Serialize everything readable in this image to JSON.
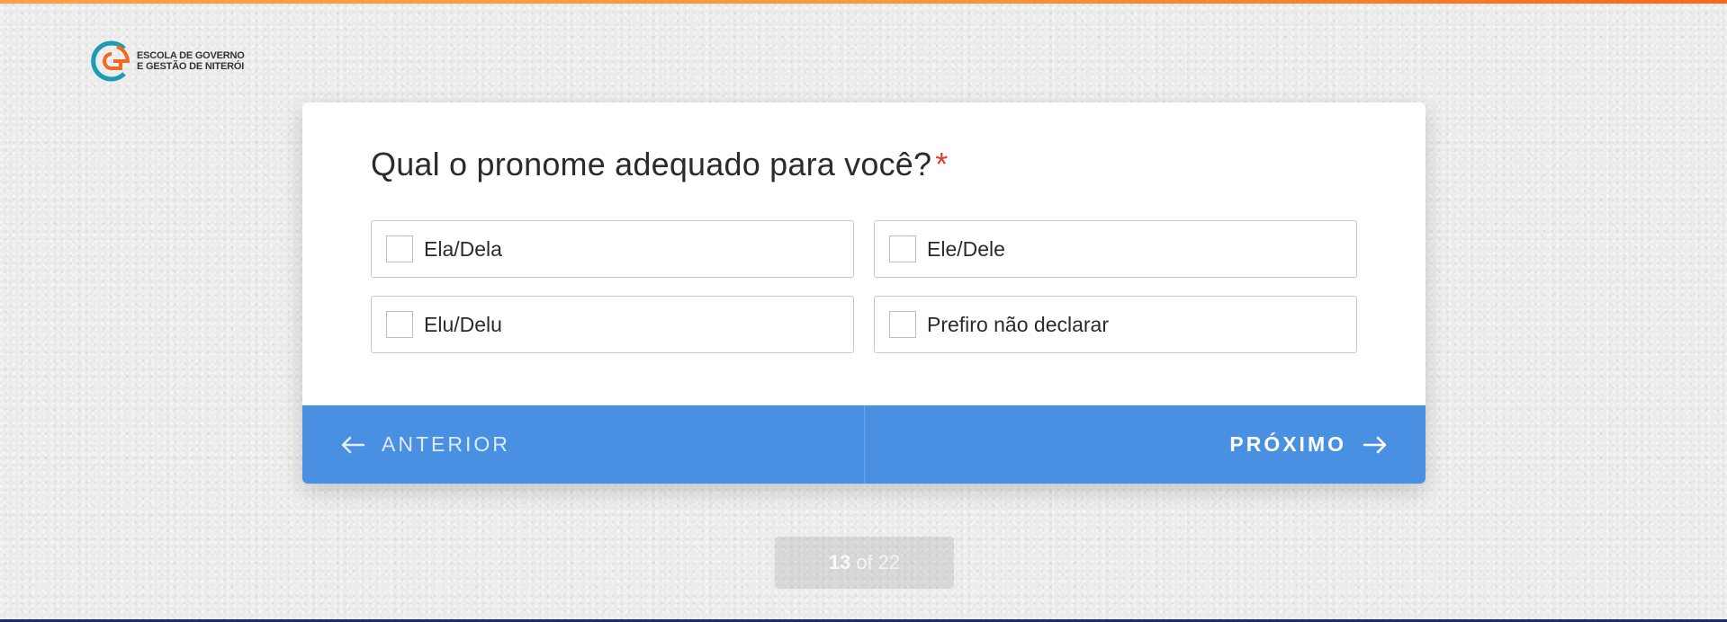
{
  "colors": {
    "accent": "#4a90e2",
    "required": "#e53935",
    "progress_start": "#f7a24a",
    "progress_end": "#f26a22",
    "bottom_line": "#1e2a6e"
  },
  "progress": {
    "fraction": 0.59
  },
  "logo": {
    "icon": "eg-logo-icon",
    "line1": "ESCOLA DE GOVERNO",
    "line2": "E GESTÃO DE NITERÓI"
  },
  "question": {
    "text": "Qual o pronome adequado para você?",
    "required_marker": "*"
  },
  "options": [
    {
      "label": "Ela/Dela",
      "checked": false
    },
    {
      "label": "Ele/Dele",
      "checked": false
    },
    {
      "label": "Elu/Delu",
      "checked": false
    },
    {
      "label": "Prefiro não declarar",
      "checked": false
    }
  ],
  "nav": {
    "prev_label": "ANTERIOR",
    "prev_icon": "arrow-left-icon",
    "next_label": "PRÓXIMO",
    "next_icon": "arrow-right-icon"
  },
  "pagination": {
    "current": "13",
    "of": "of",
    "total": "22"
  }
}
